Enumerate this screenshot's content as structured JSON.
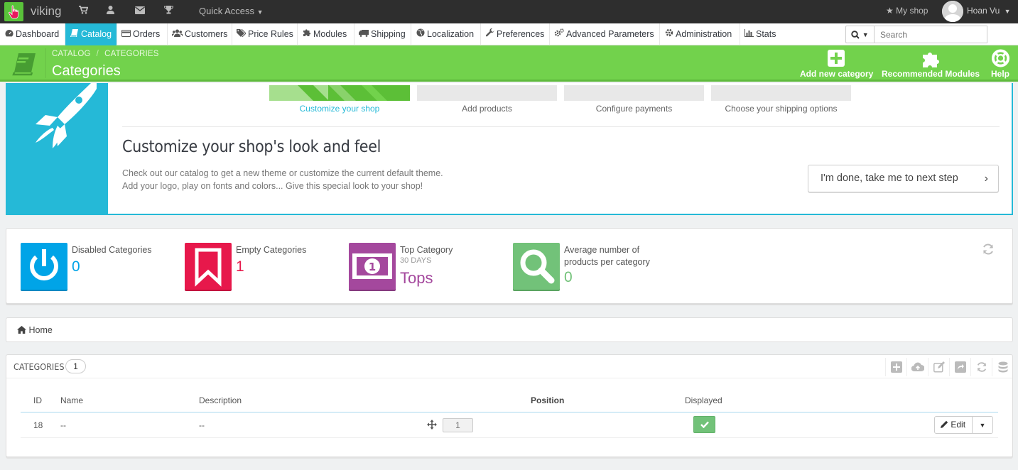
{
  "topbar": {
    "shop_name": "viking",
    "quick_access_label": "Quick Access",
    "my_shop_label": "My shop",
    "user_name": "Hoan Vu"
  },
  "nav": {
    "items": [
      {
        "label": "Dashboard",
        "icon": "dashboard-icon"
      },
      {
        "label": "Catalog",
        "icon": "book-icon",
        "active": true
      },
      {
        "label": "Orders",
        "icon": "credit-card-icon"
      },
      {
        "label": "Customers",
        "icon": "users-icon"
      },
      {
        "label": "Price Rules",
        "icon": "tags-icon"
      },
      {
        "label": "Modules",
        "icon": "puzzle-icon"
      },
      {
        "label": "Shipping",
        "icon": "truck-icon"
      },
      {
        "label": "Localization",
        "icon": "globe-icon"
      },
      {
        "label": "Preferences",
        "icon": "wrench-icon"
      },
      {
        "label": "Advanced Parameters",
        "icon": "cogs-icon"
      },
      {
        "label": "Administration",
        "icon": "cog-icon"
      },
      {
        "label": "Stats",
        "icon": "bar-chart-icon"
      }
    ],
    "search_placeholder": "Search"
  },
  "header": {
    "breadcrumb": [
      "CATALOG",
      "CATEGORIES"
    ],
    "title": "Categories",
    "buttons": {
      "add_new": "Add new category",
      "recommended": "Recommended Modules",
      "help": "Help"
    },
    "color": "#72d24c"
  },
  "onboarding": {
    "steps": [
      "Customize your shop",
      "Add products",
      "Configure payments",
      "Choose your shipping options"
    ],
    "active_step": 0,
    "title": "Customize your shop's look and feel",
    "desc_line1": "Check out our catalog to get a new theme or customize the current default theme.",
    "desc_line2": "Add your logo, play on fonts and colors... Give this special look to your shop!",
    "next_button": "I'm done, take me to next step",
    "accent": "#25b9d7"
  },
  "kpis": [
    {
      "label": "Disabled Categories",
      "value": "0",
      "color": "#00a4e7",
      "icon": "power-icon"
    },
    {
      "label": "Empty Categories",
      "value": "1",
      "color": "#e7184b",
      "icon": "bookmark-icon"
    },
    {
      "label": "Top Category",
      "sub": "30 DAYS",
      "value": "Tops",
      "color": "#a4489d",
      "icon": "money-icon"
    },
    {
      "label_line1": "Average number of",
      "label_line2": "products per category",
      "value": "0",
      "color": "#72c279",
      "icon": "search-icon"
    }
  ],
  "breadcrumb_panel": {
    "home": "Home"
  },
  "table": {
    "title": "CATEGORIES",
    "count": "1",
    "columns": [
      "ID",
      "Name",
      "Description",
      "Position",
      "Displayed"
    ],
    "rows": [
      {
        "id": "18",
        "name": "--",
        "description": "--",
        "position": "1",
        "displayed": true
      }
    ],
    "edit_label": "Edit"
  }
}
